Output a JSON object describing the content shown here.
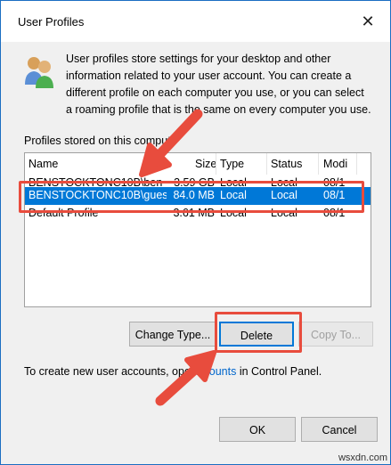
{
  "window": {
    "title": "User Profiles",
    "close_glyph": "✕"
  },
  "intro_text": "User profiles store settings for your desktop and other information related to your user account. You can create a different profile on each computer you use, or you can select a roaming profile that is the same on every computer you use.",
  "profiles_group_label": "Profiles stored on this compute",
  "table": {
    "columns": [
      "Name",
      "Size",
      "Type",
      "Status",
      "Modi"
    ],
    "rows": [
      {
        "name": "BENSTOCKTONC10B\\benst",
        "size": "3.59 GB",
        "type": "Local",
        "status": "Local",
        "modified": "08/1"
      },
      {
        "name": "BENSTOCKTONC10B\\guest...",
        "size": "84.0 MB",
        "type": "Local",
        "status": "Local",
        "modified": "08/1",
        "selected": true
      },
      {
        "name": "Default Profile",
        "size": "3.61 MB",
        "type": "Local",
        "status": "Local",
        "modified": "08/1"
      }
    ]
  },
  "buttons": {
    "change_type": "Change Type...",
    "delete": "Delete",
    "copy_to": "Copy To...",
    "ok": "OK",
    "cancel": "Cancel"
  },
  "footer": {
    "prefix": "To create new user accounts, ope",
    "link": "Accounts",
    "suffix": " in Control Panel."
  },
  "watermark": "wsxdn.com",
  "colors": {
    "selection": "#0078d7",
    "annotation": "#e84c3d",
    "link": "#0066cc"
  },
  "icons": {
    "profiles": "users-icon",
    "close": "close-icon"
  }
}
